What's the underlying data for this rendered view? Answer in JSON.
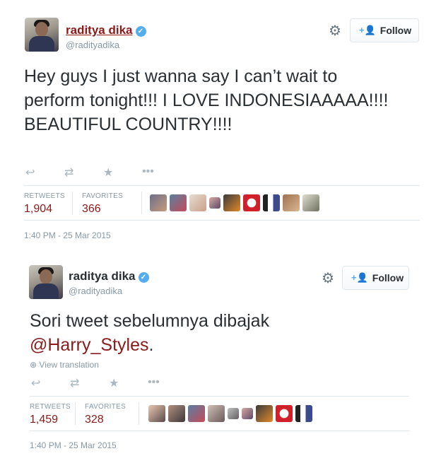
{
  "tweet1": {
    "name": "raditya dika",
    "handle": "@radityadika",
    "follow_label": "Follow",
    "text": "Hey guys I just wanna say I can’t wait to perform tonight!!! I LOVE INDONESIAAAAA!!!! BEAUTIFUL COUNTRY!!!!",
    "retweets_label": "RETWEETS",
    "retweets": "1,904",
    "favorites_label": "FAVORITES",
    "favorites": "366",
    "timestamp": "1:40 PM - 25 Mar 2015"
  },
  "tweet2": {
    "name": "raditya dika",
    "handle": "@radityadika",
    "follow_label": "Follow",
    "text_main": "Sori tweet sebelumnya dibajak",
    "mention": "@Harry_Styles",
    "text_end": ".",
    "view_translation": "View translation",
    "retweets_label": "RETWEETS",
    "retweets": "1,459",
    "favorites_label": "FAVORITES",
    "favorites": "328",
    "timestamp": "1:40 PM - 25 Mar 2015"
  },
  "icons": {
    "verified": "verified-badge-icon",
    "gear": "gear-icon",
    "follow": "add-user-icon",
    "reply": "reply-icon",
    "retweet": "retweet-icon",
    "favorite": "star-icon",
    "more": "more-icon"
  },
  "colors": {
    "link": "#8b1a1a",
    "verified": "#55acee",
    "muted": "#8899a6"
  }
}
